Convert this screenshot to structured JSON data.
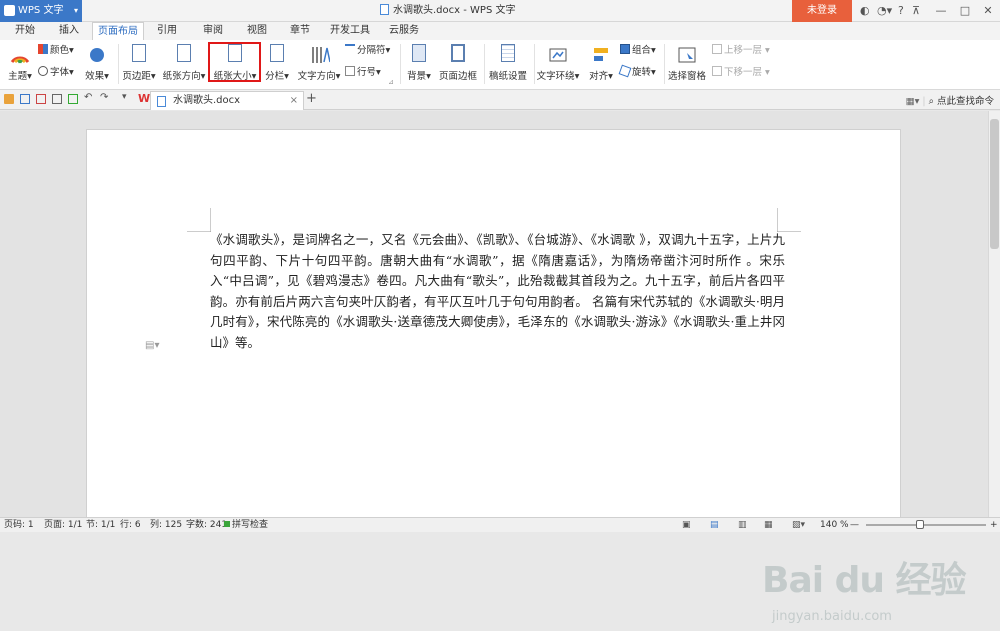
{
  "titlebar": {
    "app_name": "WPS 文字",
    "document_title": "水调歌头.docx - WPS 文字",
    "login_label": "未登录",
    "help_icon_label": "?",
    "window_buttons": [
      "—",
      "□",
      "✕"
    ]
  },
  "tabs": [
    {
      "label": "开始"
    },
    {
      "label": "插入"
    },
    {
      "label": "页面布局",
      "active": true
    },
    {
      "label": "引用"
    },
    {
      "label": "审阅"
    },
    {
      "label": "视图"
    },
    {
      "label": "章节"
    },
    {
      "label": "开发工具"
    },
    {
      "label": "云服务"
    }
  ],
  "ribbon": {
    "theme": "主题",
    "color": "颜色",
    "font": "字体",
    "effect": "效果",
    "margins": "页边距",
    "orientation": "纸张方向",
    "paper_size": "纸张大小",
    "columns": "分栏",
    "text_direction": "文字方向",
    "separator": "分隔符",
    "line_number": "行号",
    "background": "背景",
    "page_border": "页面边框",
    "manuscript": "稿纸设置",
    "text_wrap": "文字环绕",
    "align": "对齐",
    "group": "组合",
    "rotate": "旋转",
    "selection_pane": "选择窗格",
    "bring_forward": "上移一层",
    "send_backward": "下移一层"
  },
  "docbar": {
    "doc_tab": "水调歌头.docx",
    "add_tab": "+",
    "search_command": "点此查找命令"
  },
  "document": {
    "paragraph": "《水调歌头》，是词牌名之一，又名《元会曲》、《凯歌》、《台城游》、《水调歌 》，双调九十五字，上片九句四平韵、下片十句四平韵。唐朝大曲有“水调歌”，据《隋唐嘉话》，为隋炀帝凿汴河时所作 。宋乐入“中吕调”，见《碧鸡漫志》卷四。凡大曲有“歌头”，此殆裁截其首段为之。九十五字，前后片各四平韵。亦有前后片两六言句夹叶仄韵者，有平仄互叶几于句句用韵者。 名篇有宋代苏轼的《水调歌头·明月几时有》，宋代陈亮的《水调歌头·送章德茂大卿使虏》，毛泽东的《水调歌头·游泳》《水调歌头·重上井冈山》等。"
  },
  "statusbar": {
    "page_num": "页码: 1",
    "page": "页面: 1/1",
    "section": "节: 1/1",
    "row": "行: 6",
    "col": "列: 125",
    "word_count": "字数: 241",
    "spell_check": "拼写检查",
    "zoom": "140 %",
    "zoom_minus": "—",
    "zoom_plus": "+",
    "zoom_level": 0.45
  },
  "watermark": {
    "brand": "Bai du 经验",
    "url": "jingyan.baidu.com"
  },
  "colors": {
    "accent": "#3b78c8",
    "login": "#e8603c",
    "highlight": "#e01818"
  }
}
